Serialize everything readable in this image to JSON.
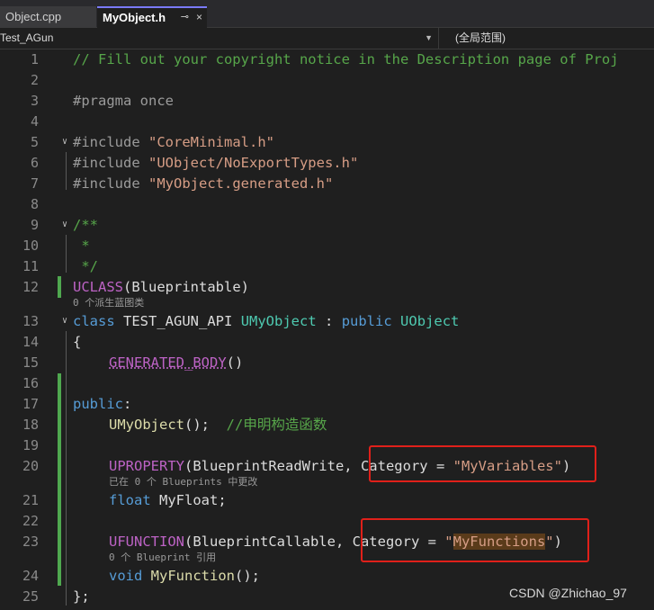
{
  "tabs": [
    {
      "label": "Object.cpp",
      "active": false
    },
    {
      "label": "MyObject.h",
      "active": true,
      "pin": "⊸",
      "close": "×"
    }
  ],
  "nav": {
    "left": "Test_AGun",
    "right": "(全局范围)"
  },
  "lines": [
    {
      "num": "1"
    },
    {
      "num": "2"
    },
    {
      "num": "3"
    },
    {
      "num": "4"
    },
    {
      "num": "5"
    },
    {
      "num": "6"
    },
    {
      "num": "7"
    },
    {
      "num": "8"
    },
    {
      "num": "9"
    },
    {
      "num": "10"
    },
    {
      "num": "11"
    },
    {
      "num": "12"
    },
    {
      "num": "13"
    },
    {
      "num": "14"
    },
    {
      "num": "15"
    },
    {
      "num": "16"
    },
    {
      "num": "17"
    },
    {
      "num": "18"
    },
    {
      "num": "19"
    },
    {
      "num": "20"
    },
    {
      "num": "21"
    },
    {
      "num": "22"
    },
    {
      "num": "23"
    },
    {
      "num": "24"
    },
    {
      "num": "25"
    }
  ],
  "code": {
    "l1": "// Fill out your copyright notice in the Description page of Proj",
    "l3_kw": "#pragma",
    "l3_rest": " once",
    "l5_kw": "#include",
    "l5_str": "\"CoreMinimal.h\"",
    "l6_kw": "#include",
    "l6_str": "\"UObject/NoExportTypes.h\"",
    "l7_kw": "#include",
    "l7_str": "\"MyObject.generated.h\"",
    "l9": "/**",
    "l10": " *",
    "l11": " */",
    "l12_mac": "UCLASS",
    "l12_rest": "(Blueprintable)",
    "l12_hint": "0 个派生蓝图类",
    "l13_kw": "class",
    "l13_api": "TEST_AGUN_API",
    "l13_type": "UMyObject",
    "l13_colon": " : ",
    "l13_pub": "public",
    "l13_base": "UObject",
    "l14": "{",
    "l15_mac": "GENERATED_BODY",
    "l15_rest": "()",
    "l17_kw": "public",
    "l17_rest": ":",
    "l18_fn": "UMyObject",
    "l18_rest": "();  ",
    "l18_cmt": "//申明构造函数",
    "l20_mac": "UPROPERTY",
    "l20_a": "(BlueprintReadWrite, ",
    "l20_b": "Category = ",
    "l20_str": "\"MyVariables\"",
    "l20_c": ")",
    "l20_hint": "已在 0 个 Blueprints 中更改",
    "l21_kw": "float",
    "l21_rest": " MyFloat;",
    "l23_mac": "UFUNCTION",
    "l23_a": "(BlueprintCallable, ",
    "l23_b": "Category = ",
    "l23_q1": "\"",
    "l23_str": "MyFunctions",
    "l23_q2": "\"",
    "l23_c": ")",
    "l23_hint": "0 个 Blueprint 引用",
    "l24_kw": "void",
    "l24_fn": "MyFunction",
    "l24_rest": "();",
    "l25": "};"
  },
  "watermark": "CSDN @Zhichao_97",
  "colors": {
    "comment": "#57a64a",
    "keyword": "#569cd6",
    "string": "#d69d85",
    "type": "#4ec9b0",
    "macro": "#bd63c5",
    "highlight_box": "#e0201a"
  }
}
